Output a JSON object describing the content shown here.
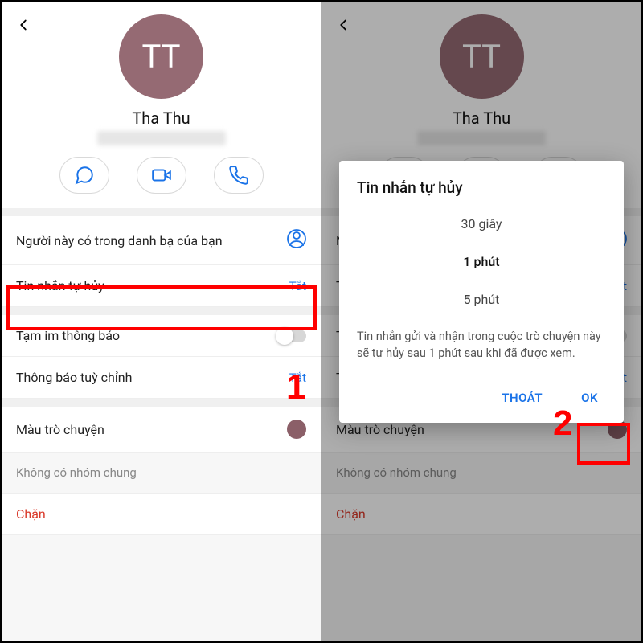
{
  "profile": {
    "avatar_initials": "TT",
    "name": "Tha Thu"
  },
  "rows": {
    "in_contacts": "Người này có trong danh bạ của bạn",
    "self_destruct": {
      "label": "Tin nhắn tự hủy",
      "value": "Tắt"
    },
    "mute": "Tạm im thông báo",
    "custom_notify": {
      "label": "Thông báo tuỳ chỉnh",
      "value": "Tắt"
    },
    "chat_color": "Màu trò chuyện",
    "no_groups": "Không có nhóm chung",
    "block": "Chặn"
  },
  "dialog": {
    "title": "Tin nhắn tự hủy",
    "options": [
      "30 giây",
      "1 phút",
      "5 phút"
    ],
    "description": "Tin nhắn gửi và nhận trong cuộc trò chuyện này sẽ tự hủy sau 1 phút sau khi đã được xem.",
    "cancel": "THOÁT",
    "ok": "OK"
  },
  "callouts": {
    "one": "1",
    "two": "2"
  }
}
